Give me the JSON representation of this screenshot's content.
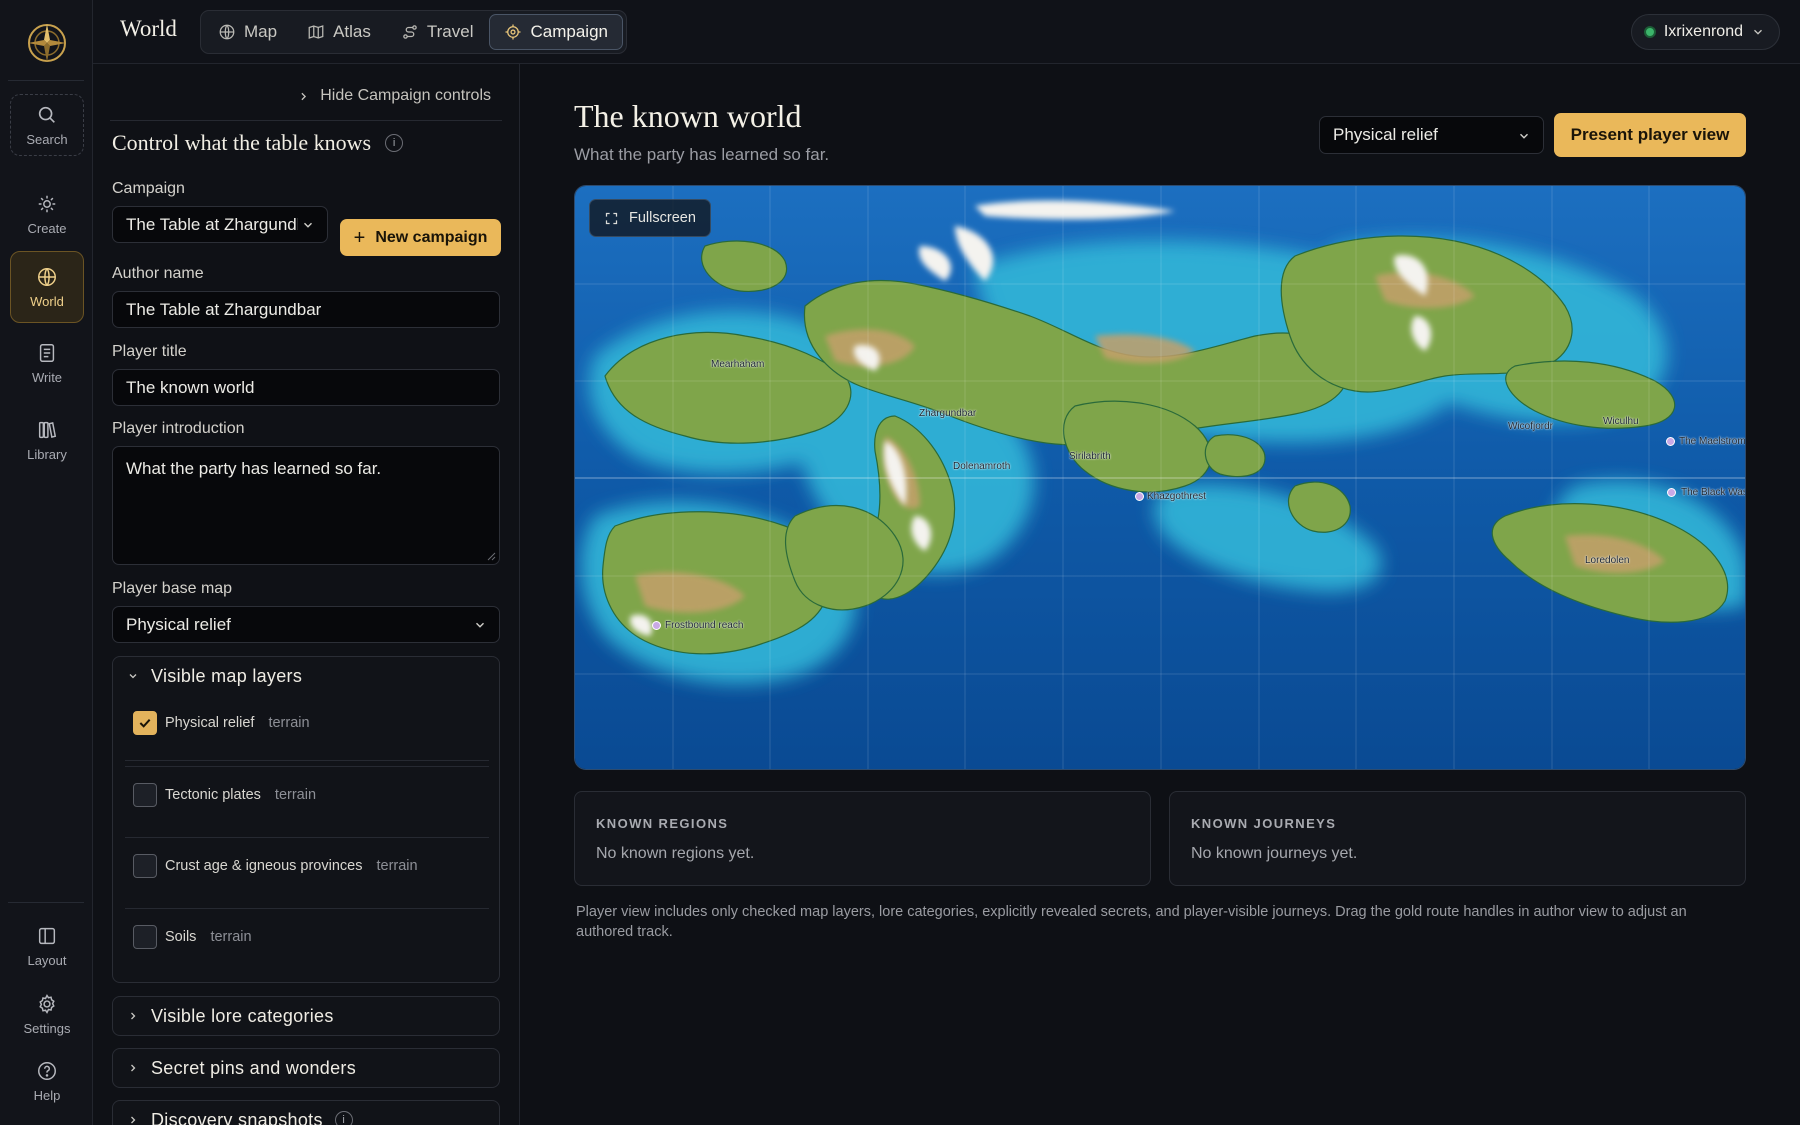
{
  "app": {
    "section_title": "World",
    "logo_icon": "compass-emblem-icon"
  },
  "rail": {
    "items": [
      {
        "label": "Search",
        "icon": "search-icon"
      },
      {
        "label": "Create",
        "icon": "sparkle-icon"
      },
      {
        "label": "World",
        "icon": "globe-icon",
        "active": true
      },
      {
        "label": "Write",
        "icon": "document-icon"
      },
      {
        "label": "Library",
        "icon": "books-icon"
      },
      {
        "label": "Layout",
        "icon": "layout-icon"
      },
      {
        "label": "Settings",
        "icon": "gear-icon"
      },
      {
        "label": "Help",
        "icon": "help-icon"
      }
    ]
  },
  "tabs": [
    {
      "label": "Map",
      "icon": "globe-icon"
    },
    {
      "label": "Atlas",
      "icon": "map-icon"
    },
    {
      "label": "Travel",
      "icon": "route-icon"
    },
    {
      "label": "Campaign",
      "icon": "target-icon",
      "active": true
    }
  ],
  "user": {
    "name": "Ixrixenrond",
    "status_color": "#3cb56b"
  },
  "panel": {
    "hide_label": "Hide Campaign controls",
    "heading": "Control what the table knows",
    "info_glyph": "i",
    "campaign_label": "Campaign",
    "campaign_value": "The Table at Zhargundbar",
    "new_campaign_label": "New campaign",
    "author_label": "Author name",
    "author_value": "The Table at Zhargundbar",
    "player_title_label": "Player title",
    "player_title_value": "The known world",
    "intro_label": "Player introduction",
    "intro_value": "What the party has learned so far.",
    "base_map_label": "Player base map",
    "base_map_value": "Physical relief",
    "layers_heading": "Visible map layers",
    "layers": [
      {
        "name": "Physical relief",
        "tag": "terrain",
        "checked": true
      },
      {
        "name": "Tectonic plates",
        "tag": "terrain",
        "checked": false
      },
      {
        "name": "Crust age & igneous provinces",
        "tag": "terrain",
        "checked": false
      },
      {
        "name": "Soils",
        "tag": "terrain",
        "checked": false
      }
    ],
    "lore_heading": "Visible lore categories",
    "secrets_heading": "Secret pins and wonders",
    "snapshots_heading": "Discovery snapshots"
  },
  "main": {
    "title": "The known world",
    "subtitle": "What the party has learned so far.",
    "base_map_select": "Physical relief",
    "present_button": "Present player view",
    "fullscreen_label": "Fullscreen",
    "places": [
      "Mearhaham",
      "Zhargundbar",
      "Dolenamroth",
      "Sirilabrith",
      "Khazgothrest",
      "Wicofjordr",
      "Wiculhu",
      "The Maelstrom",
      "The Black Waste",
      "Loredolen",
      "Frostbound reach"
    ],
    "regions_title": "KNOWN REGIONS",
    "regions_value": "No known regions yet.",
    "journeys_title": "KNOWN JOURNEYS",
    "journeys_value": "No known journeys yet.",
    "footnote": "Player view includes only checked map layers, lore categories, explicitly revealed secrets, and player-visible journeys. Drag the gold route handles in author view to adjust an authored track."
  },
  "colors": {
    "accent_gold": "#eab85a",
    "background": "#0e1015",
    "ocean_deep": "#0d4f9e",
    "ocean_shallow": "#2fb3d6",
    "land_low": "#8fae4b",
    "land_high": "#c9a56e",
    "snow": "#f4f3ef"
  }
}
